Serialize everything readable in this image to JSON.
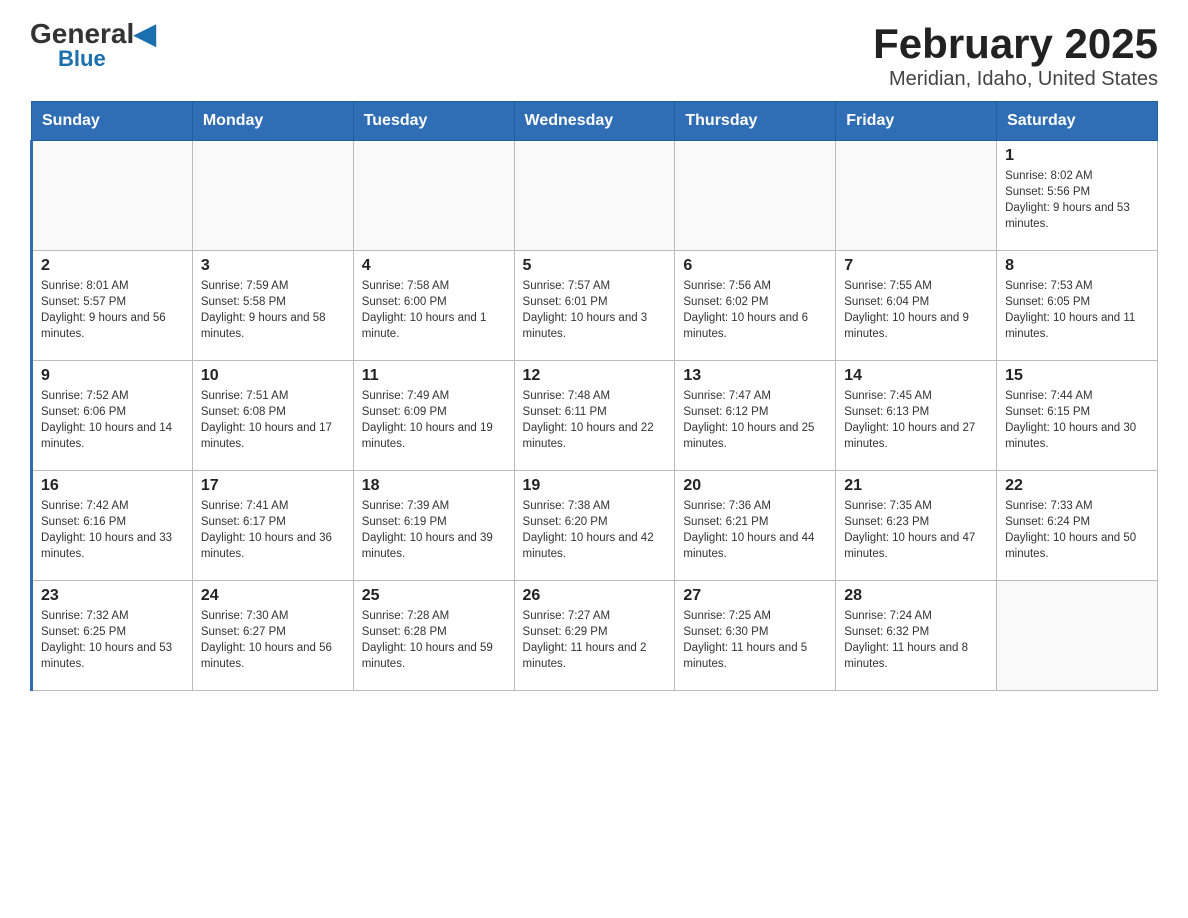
{
  "header": {
    "logo_general": "General",
    "logo_blue": "Blue",
    "title": "February 2025",
    "subtitle": "Meridian, Idaho, United States"
  },
  "days_of_week": [
    "Sunday",
    "Monday",
    "Tuesday",
    "Wednesday",
    "Thursday",
    "Friday",
    "Saturday"
  ],
  "weeks": [
    [
      {
        "day": "",
        "sunrise": "",
        "sunset": "",
        "daylight": ""
      },
      {
        "day": "",
        "sunrise": "",
        "sunset": "",
        "daylight": ""
      },
      {
        "day": "",
        "sunrise": "",
        "sunset": "",
        "daylight": ""
      },
      {
        "day": "",
        "sunrise": "",
        "sunset": "",
        "daylight": ""
      },
      {
        "day": "",
        "sunrise": "",
        "sunset": "",
        "daylight": ""
      },
      {
        "day": "",
        "sunrise": "",
        "sunset": "",
        "daylight": ""
      },
      {
        "day": "1",
        "sunrise": "Sunrise: 8:02 AM",
        "sunset": "Sunset: 5:56 PM",
        "daylight": "Daylight: 9 hours and 53 minutes."
      }
    ],
    [
      {
        "day": "2",
        "sunrise": "Sunrise: 8:01 AM",
        "sunset": "Sunset: 5:57 PM",
        "daylight": "Daylight: 9 hours and 56 minutes."
      },
      {
        "day": "3",
        "sunrise": "Sunrise: 7:59 AM",
        "sunset": "Sunset: 5:58 PM",
        "daylight": "Daylight: 9 hours and 58 minutes."
      },
      {
        "day": "4",
        "sunrise": "Sunrise: 7:58 AM",
        "sunset": "Sunset: 6:00 PM",
        "daylight": "Daylight: 10 hours and 1 minute."
      },
      {
        "day": "5",
        "sunrise": "Sunrise: 7:57 AM",
        "sunset": "Sunset: 6:01 PM",
        "daylight": "Daylight: 10 hours and 3 minutes."
      },
      {
        "day": "6",
        "sunrise": "Sunrise: 7:56 AM",
        "sunset": "Sunset: 6:02 PM",
        "daylight": "Daylight: 10 hours and 6 minutes."
      },
      {
        "day": "7",
        "sunrise": "Sunrise: 7:55 AM",
        "sunset": "Sunset: 6:04 PM",
        "daylight": "Daylight: 10 hours and 9 minutes."
      },
      {
        "day": "8",
        "sunrise": "Sunrise: 7:53 AM",
        "sunset": "Sunset: 6:05 PM",
        "daylight": "Daylight: 10 hours and 11 minutes."
      }
    ],
    [
      {
        "day": "9",
        "sunrise": "Sunrise: 7:52 AM",
        "sunset": "Sunset: 6:06 PM",
        "daylight": "Daylight: 10 hours and 14 minutes."
      },
      {
        "day": "10",
        "sunrise": "Sunrise: 7:51 AM",
        "sunset": "Sunset: 6:08 PM",
        "daylight": "Daylight: 10 hours and 17 minutes."
      },
      {
        "day": "11",
        "sunrise": "Sunrise: 7:49 AM",
        "sunset": "Sunset: 6:09 PM",
        "daylight": "Daylight: 10 hours and 19 minutes."
      },
      {
        "day": "12",
        "sunrise": "Sunrise: 7:48 AM",
        "sunset": "Sunset: 6:11 PM",
        "daylight": "Daylight: 10 hours and 22 minutes."
      },
      {
        "day": "13",
        "sunrise": "Sunrise: 7:47 AM",
        "sunset": "Sunset: 6:12 PM",
        "daylight": "Daylight: 10 hours and 25 minutes."
      },
      {
        "day": "14",
        "sunrise": "Sunrise: 7:45 AM",
        "sunset": "Sunset: 6:13 PM",
        "daylight": "Daylight: 10 hours and 27 minutes."
      },
      {
        "day": "15",
        "sunrise": "Sunrise: 7:44 AM",
        "sunset": "Sunset: 6:15 PM",
        "daylight": "Daylight: 10 hours and 30 minutes."
      }
    ],
    [
      {
        "day": "16",
        "sunrise": "Sunrise: 7:42 AM",
        "sunset": "Sunset: 6:16 PM",
        "daylight": "Daylight: 10 hours and 33 minutes."
      },
      {
        "day": "17",
        "sunrise": "Sunrise: 7:41 AM",
        "sunset": "Sunset: 6:17 PM",
        "daylight": "Daylight: 10 hours and 36 minutes."
      },
      {
        "day": "18",
        "sunrise": "Sunrise: 7:39 AM",
        "sunset": "Sunset: 6:19 PM",
        "daylight": "Daylight: 10 hours and 39 minutes."
      },
      {
        "day": "19",
        "sunrise": "Sunrise: 7:38 AM",
        "sunset": "Sunset: 6:20 PM",
        "daylight": "Daylight: 10 hours and 42 minutes."
      },
      {
        "day": "20",
        "sunrise": "Sunrise: 7:36 AM",
        "sunset": "Sunset: 6:21 PM",
        "daylight": "Daylight: 10 hours and 44 minutes."
      },
      {
        "day": "21",
        "sunrise": "Sunrise: 7:35 AM",
        "sunset": "Sunset: 6:23 PM",
        "daylight": "Daylight: 10 hours and 47 minutes."
      },
      {
        "day": "22",
        "sunrise": "Sunrise: 7:33 AM",
        "sunset": "Sunset: 6:24 PM",
        "daylight": "Daylight: 10 hours and 50 minutes."
      }
    ],
    [
      {
        "day": "23",
        "sunrise": "Sunrise: 7:32 AM",
        "sunset": "Sunset: 6:25 PM",
        "daylight": "Daylight: 10 hours and 53 minutes."
      },
      {
        "day": "24",
        "sunrise": "Sunrise: 7:30 AM",
        "sunset": "Sunset: 6:27 PM",
        "daylight": "Daylight: 10 hours and 56 minutes."
      },
      {
        "day": "25",
        "sunrise": "Sunrise: 7:28 AM",
        "sunset": "Sunset: 6:28 PM",
        "daylight": "Daylight: 10 hours and 59 minutes."
      },
      {
        "day": "26",
        "sunrise": "Sunrise: 7:27 AM",
        "sunset": "Sunset: 6:29 PM",
        "daylight": "Daylight: 11 hours and 2 minutes."
      },
      {
        "day": "27",
        "sunrise": "Sunrise: 7:25 AM",
        "sunset": "Sunset: 6:30 PM",
        "daylight": "Daylight: 11 hours and 5 minutes."
      },
      {
        "day": "28",
        "sunrise": "Sunrise: 7:24 AM",
        "sunset": "Sunset: 6:32 PM",
        "daylight": "Daylight: 11 hours and 8 minutes."
      },
      {
        "day": "",
        "sunrise": "",
        "sunset": "",
        "daylight": ""
      }
    ]
  ]
}
